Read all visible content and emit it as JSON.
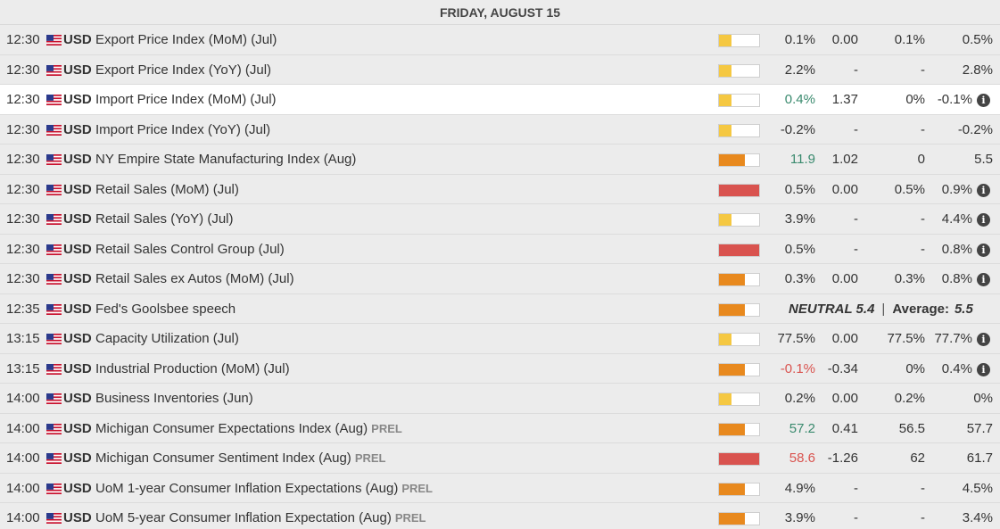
{
  "header": {
    "date": "FRIDAY, AUGUST 15"
  },
  "colors": {
    "impact_low": "#f5c842",
    "impact_medium": "#e8891e",
    "impact_high": "#d9534f",
    "positive": "#3a8a6e",
    "negative": "#d9534f"
  },
  "rows": [
    {
      "time": "12:30",
      "currency": "USD",
      "event": "Export Price Index (MoM) (Jul)",
      "prel": "",
      "impact": "low",
      "actual": "0.1%",
      "actual_color": "",
      "forecast": "0.00",
      "previous": "0.1%",
      "consensus": "0.5%",
      "info": false,
      "highlight": false
    },
    {
      "time": "12:30",
      "currency": "USD",
      "event": "Export Price Index (YoY) (Jul)",
      "prel": "",
      "impact": "low",
      "actual": "2.2%",
      "actual_color": "",
      "forecast": "-",
      "previous": "-",
      "consensus": "2.8%",
      "info": false,
      "highlight": false
    },
    {
      "time": "12:30",
      "currency": "USD",
      "event": "Import Price Index (MoM) (Jul)",
      "prel": "",
      "impact": "low",
      "actual": "0.4%",
      "actual_color": "pos",
      "forecast": "1.37",
      "previous": "0%",
      "consensus": "-0.1%",
      "info": true,
      "highlight": true
    },
    {
      "time": "12:30",
      "currency": "USD",
      "event": "Import Price Index (YoY) (Jul)",
      "prel": "",
      "impact": "low",
      "actual": "-0.2%",
      "actual_color": "",
      "forecast": "-",
      "previous": "-",
      "consensus": "-0.2%",
      "info": false,
      "highlight": false
    },
    {
      "time": "12:30",
      "currency": "USD",
      "event": "NY Empire State Manufacturing Index (Aug)",
      "prel": "",
      "impact": "medium",
      "actual": "11.9",
      "actual_color": "pos",
      "forecast": "1.02",
      "previous": "0",
      "consensus": "5.5",
      "info": false,
      "highlight": false
    },
    {
      "time": "12:30",
      "currency": "USD",
      "event": "Retail Sales (MoM) (Jul)",
      "prel": "",
      "impact": "high",
      "actual": "0.5%",
      "actual_color": "",
      "forecast": "0.00",
      "previous": "0.5%",
      "consensus": "0.9%",
      "info": true,
      "highlight": false
    },
    {
      "time": "12:30",
      "currency": "USD",
      "event": "Retail Sales (YoY) (Jul)",
      "prel": "",
      "impact": "low",
      "actual": "3.9%",
      "actual_color": "",
      "forecast": "-",
      "previous": "-",
      "consensus": "4.4%",
      "info": true,
      "highlight": false
    },
    {
      "time": "12:30",
      "currency": "USD",
      "event": "Retail Sales Control Group (Jul)",
      "prel": "",
      "impact": "high",
      "actual": "0.5%",
      "actual_color": "",
      "forecast": "-",
      "previous": "-",
      "consensus": "0.8%",
      "info": true,
      "highlight": false
    },
    {
      "time": "12:30",
      "currency": "USD",
      "event": "Retail Sales ex Autos (MoM) (Jul)",
      "prel": "",
      "impact": "medium",
      "actual": "0.3%",
      "actual_color": "",
      "forecast": "0.00",
      "previous": "0.3%",
      "consensus": "0.8%",
      "info": true,
      "highlight": false
    },
    {
      "time": "12:35",
      "currency": "USD",
      "event": "Fed's Goolsbee speech",
      "prel": "",
      "impact": "medium",
      "speech": true,
      "neutral_label": "NEUTRAL 5.4",
      "sep": "|",
      "average_label": "Average:",
      "average_value": "5.5",
      "highlight": false
    },
    {
      "time": "13:15",
      "currency": "USD",
      "event": "Capacity Utilization (Jul)",
      "prel": "",
      "impact": "low",
      "actual": "77.5%",
      "actual_color": "",
      "forecast": "0.00",
      "previous": "77.5%",
      "consensus": "77.7%",
      "info": true,
      "highlight": false
    },
    {
      "time": "13:15",
      "currency": "USD",
      "event": "Industrial Production (MoM) (Jul)",
      "prel": "",
      "impact": "medium",
      "actual": "-0.1%",
      "actual_color": "neg",
      "forecast": "-0.34",
      "previous": "0%",
      "consensus": "0.4%",
      "info": true,
      "highlight": false
    },
    {
      "time": "14:00",
      "currency": "USD",
      "event": "Business Inventories (Jun)",
      "prel": "",
      "impact": "low",
      "actual": "0.2%",
      "actual_color": "",
      "forecast": "0.00",
      "previous": "0.2%",
      "consensus": "0%",
      "info": false,
      "highlight": false
    },
    {
      "time": "14:00",
      "currency": "USD",
      "event": "Michigan Consumer Expectations Index (Aug)",
      "prel": "PREL",
      "impact": "medium",
      "actual": "57.2",
      "actual_color": "pos",
      "forecast": "0.41",
      "previous": "56.5",
      "consensus": "57.7",
      "info": false,
      "highlight": false
    },
    {
      "time": "14:00",
      "currency": "USD",
      "event": "Michigan Consumer Sentiment Index (Aug)",
      "prel": "PREL",
      "impact": "high",
      "actual": "58.6",
      "actual_color": "neg",
      "forecast": "-1.26",
      "previous": "62",
      "consensus": "61.7",
      "info": false,
      "highlight": false
    },
    {
      "time": "14:00",
      "currency": "USD",
      "event": "UoM 1-year Consumer Inflation Expectations (Aug)",
      "prel": "PREL",
      "impact": "medium",
      "actual": "4.9%",
      "actual_color": "",
      "forecast": "-",
      "previous": "-",
      "consensus": "4.5%",
      "info": false,
      "highlight": false
    },
    {
      "time": "14:00",
      "currency": "USD",
      "event": "UoM 5-year Consumer Inflation Expectation (Aug)",
      "prel": "PREL",
      "impact": "medium",
      "actual": "3.9%",
      "actual_color": "",
      "forecast": "-",
      "previous": "-",
      "consensus": "3.4%",
      "info": false,
      "highlight": false
    }
  ]
}
